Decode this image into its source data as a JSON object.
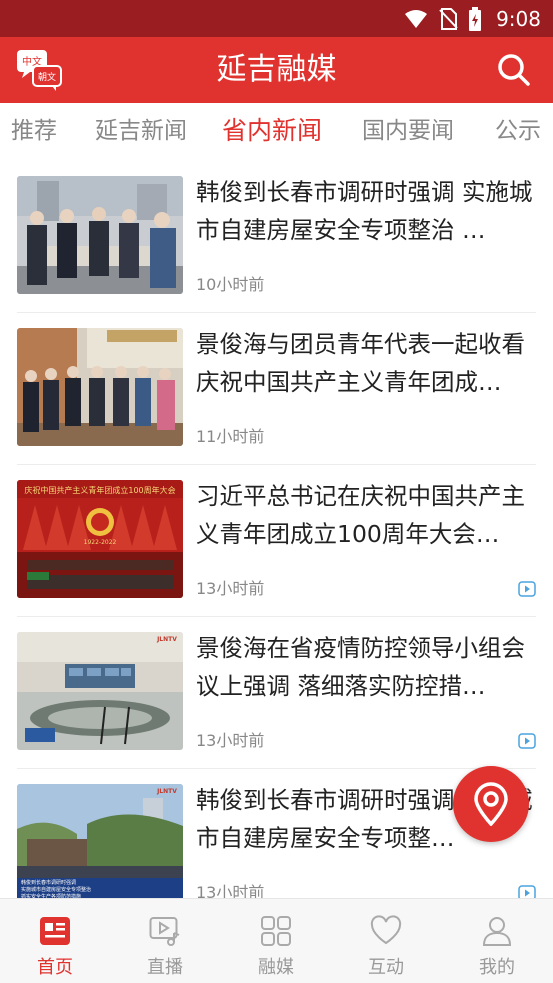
{
  "status_bar": {
    "time": "9:08"
  },
  "app_bar": {
    "title": "延吉融媒",
    "logo_text_top": "中文",
    "logo_text_bottom": "朝文"
  },
  "tabs": [
    {
      "label": "推荐"
    },
    {
      "label": "延吉新闻"
    },
    {
      "label": "省内新闻",
      "active": true
    },
    {
      "label": "国内要闻"
    },
    {
      "label": "公示"
    }
  ],
  "news": [
    {
      "title": "韩俊到长春市调研时强调 实施城市自建房屋安全专项整治 …",
      "time": "10小时前",
      "has_video": false
    },
    {
      "title": "景俊海与团员青年代表一起收看庆祝中国共产主义青年团成…",
      "time": "11小时前",
      "has_video": false
    },
    {
      "title": "习近平总书记在庆祝中国共产主义青年团成立100周年大会…",
      "time": "13小时前",
      "has_video": true
    },
    {
      "title": "景俊海在省疫情防控领导小组会议上强调 落细落实防控措…",
      "time": "13小时前",
      "has_video": true
    },
    {
      "title": "韩俊到长春市调研时强调 实施城市自建房屋安全专项整…",
      "time": "13小时前",
      "has_video": true
    }
  ],
  "thumb_captions": {
    "news3_banner": "庆祝中国共产主义青年团成立100周年大会",
    "news3_years": "1922-2022",
    "news5_line1": "韩俊到长春市调研时强调",
    "news5_line2": "实施城市自建房屋安全专项整治",
    "news5_line3": "抓实安全生产各项防范措施",
    "logo_tv": "JLNTV"
  },
  "bottom_nav": [
    {
      "label": "首页",
      "icon": "news-icon",
      "active": true
    },
    {
      "label": "直播",
      "icon": "live-icon"
    },
    {
      "label": "融媒",
      "icon": "grid-icon"
    },
    {
      "label": "互动",
      "icon": "heart-icon"
    },
    {
      "label": "我的",
      "icon": "user-icon"
    }
  ],
  "colors": {
    "brand_red": "#e0332f",
    "status_bar": "#9a1e21",
    "muted_text": "#888888",
    "video_badge": "#4aa3df"
  }
}
